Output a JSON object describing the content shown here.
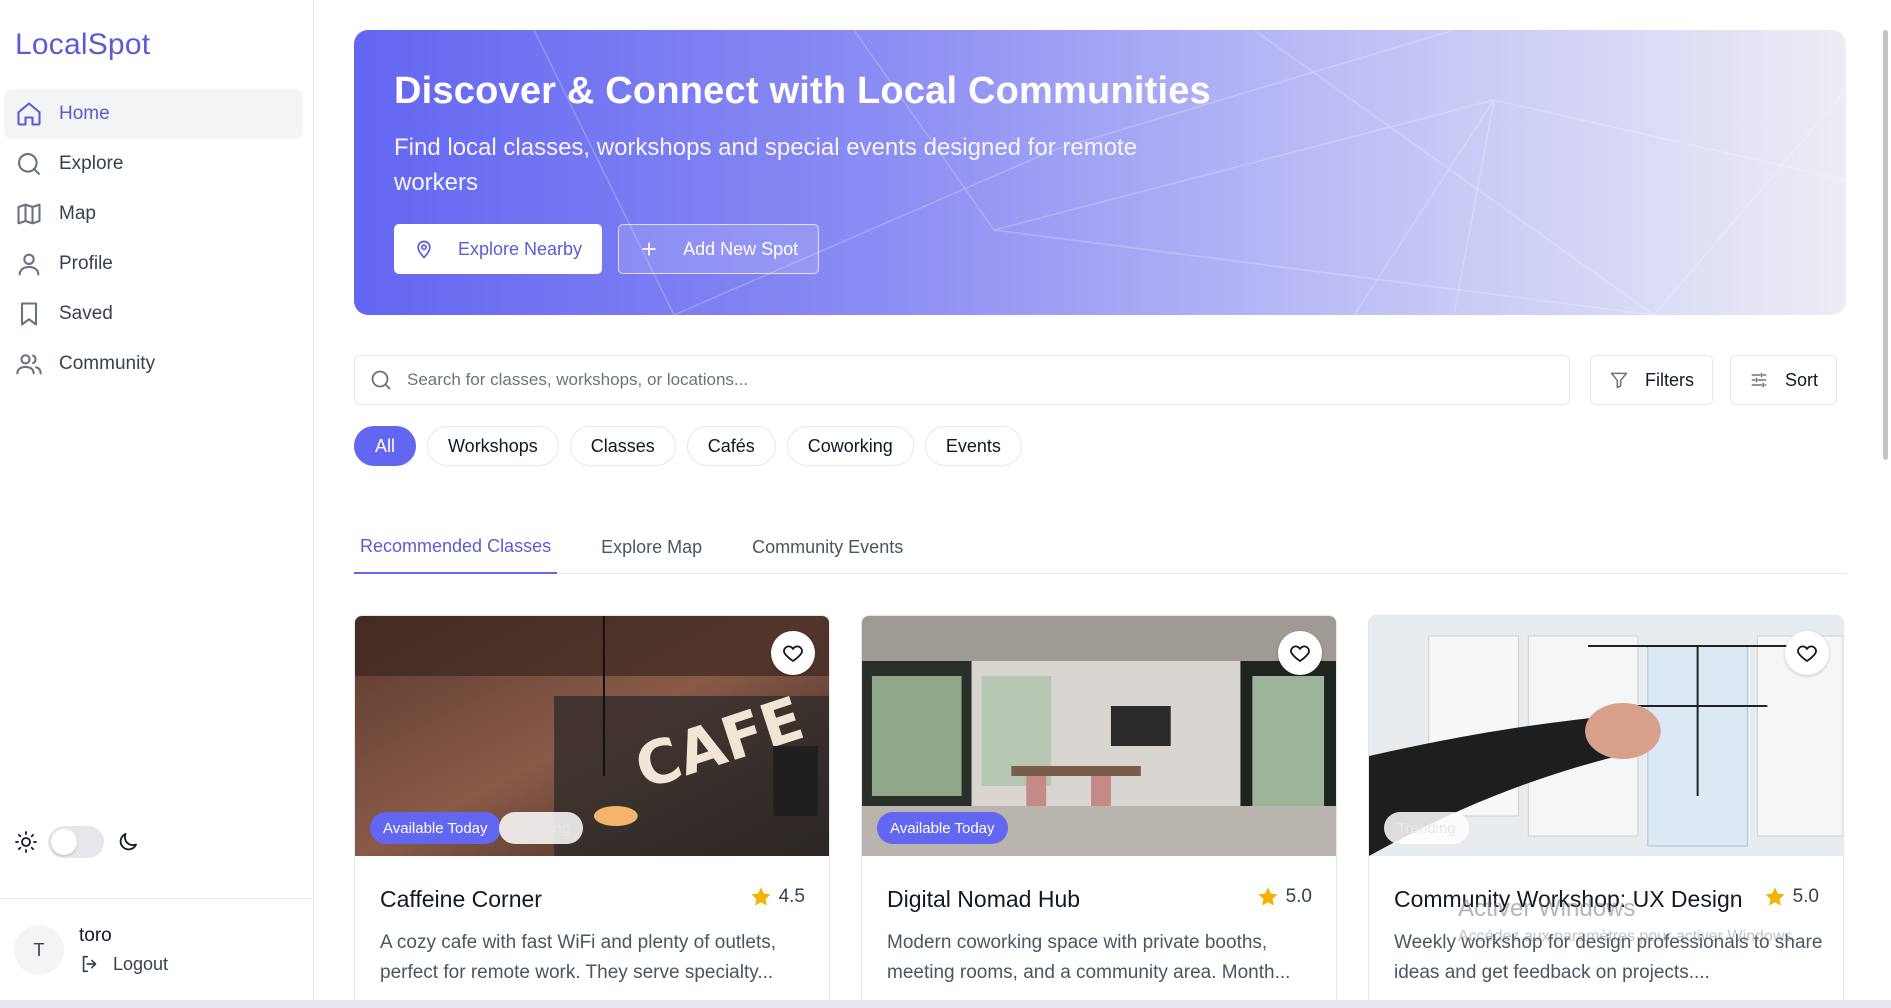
{
  "app": {
    "logo": "LocalSpot"
  },
  "sidebar": {
    "items": [
      {
        "label": "Home",
        "icon": "home-icon",
        "active": true
      },
      {
        "label": "Explore",
        "icon": "search-icon"
      },
      {
        "label": "Map",
        "icon": "map-icon"
      },
      {
        "label": "Profile",
        "icon": "user-icon"
      },
      {
        "label": "Saved",
        "icon": "bookmark-icon"
      },
      {
        "label": "Community",
        "icon": "users-icon"
      }
    ],
    "theme": {
      "light_icon": "sun-icon",
      "dark_icon": "moon-icon",
      "dark_mode": false
    },
    "user": {
      "initial": "T",
      "name": "toro",
      "logout_label": "Logout"
    }
  },
  "hero": {
    "title": "Discover & Connect with Local Communities",
    "subtitle": "Find local classes, workshops and special events designed for remote workers",
    "primary_button": "Explore Nearby",
    "secondary_button": "Add New Spot"
  },
  "search": {
    "placeholder": "Search for classes, workshops, or locations...",
    "filters_label": "Filters",
    "sort_label": "Sort"
  },
  "categories": [
    "All",
    "Workshops",
    "Classes",
    "Cafés",
    "Coworking",
    "Events"
  ],
  "tabs": [
    "Recommended Classes",
    "Explore Map",
    "Community Events"
  ],
  "cards": [
    {
      "title": "Caffeine Corner",
      "rating": "4.5",
      "description": "A cozy cafe with fast WiFi and plenty of outlets, perfect for remote work. They serve specialty...",
      "badges": [
        "Available Today",
        "Trending"
      ]
    },
    {
      "title": "Digital Nomad Hub",
      "rating": "5.0",
      "description": "Modern coworking space with private booths, meeting rooms, and a community area. Month...",
      "badges": [
        "Available Today"
      ]
    },
    {
      "title": "Community Workshop: UX Design",
      "rating": "5.0",
      "description": "Weekly workshop for design professionals to share ideas and get feedback on projects....",
      "badges": [
        "Trending"
      ]
    }
  ],
  "overlay": {
    "watermark_title": "Activer Windows",
    "watermark_sub": "Accédez aux paramètres pour activer Windows."
  },
  "colors": {
    "accent": "#6366f1",
    "brand": "#5b5bd6",
    "star": "#f5b301"
  }
}
